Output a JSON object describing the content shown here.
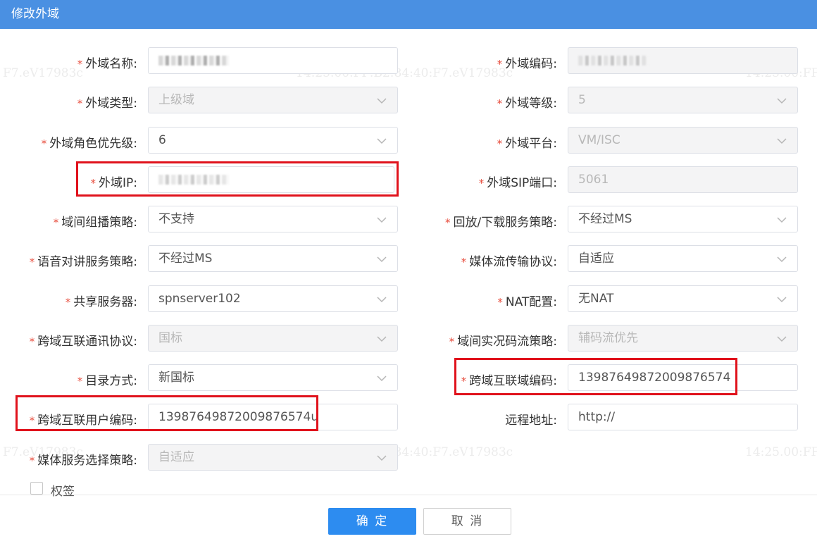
{
  "dialog": {
    "title": "修改外域"
  },
  "watermark": {
    "a": "F7.eV17983c",
    "b": "14:25.00:FF:B2:84:40:F7.eV17983c",
    "c": "14:25.00:FF:"
  },
  "fields": {
    "name": {
      "label": "外域名称:",
      "value": ""
    },
    "code": {
      "label": "外域编码:",
      "value": ""
    },
    "type": {
      "label": "外域类型:",
      "value": "上级域"
    },
    "level": {
      "label": "外域等级:",
      "value": "5"
    },
    "role": {
      "label": "外域角色优先级:",
      "value": "6"
    },
    "platform": {
      "label": "外域平台:",
      "value": "VM/ISC"
    },
    "ip": {
      "label": "外域IP:",
      "value": ""
    },
    "sip_port": {
      "label": "外域SIP端口:",
      "value": "5061"
    },
    "multicast": {
      "label": "域间组播策略:",
      "value": "不支持"
    },
    "playback": {
      "label": "回放/下载服务策略:",
      "value": "不经过MS"
    },
    "voice": {
      "label": "语音对讲服务策略:",
      "value": "不经过MS"
    },
    "transport": {
      "label": "媒体流传输协议:",
      "value": "自适应"
    },
    "share": {
      "label": "共享服务器:",
      "value": "spnserver102"
    },
    "nat": {
      "label": "NAT配置:",
      "value": "无NAT"
    },
    "protocol": {
      "label": "跨域互联通讯协议:",
      "value": "国标"
    },
    "stream": {
      "label": "域间实况码流策略:",
      "value": "辅码流优先"
    },
    "catalog": {
      "label": "目录方式:",
      "value": "新国标"
    },
    "domain_code": {
      "label": "跨域互联域编码:",
      "value": "13987649872009876574"
    },
    "user_code": {
      "label": "跨域互联用户编码:",
      "value": "13987649872009876574u"
    },
    "remote": {
      "label": "远程地址:",
      "value": "http://"
    },
    "media": {
      "label": "媒体服务选择策略:",
      "value": "自适应"
    }
  },
  "signature": {
    "label": "权签",
    "checked": false
  },
  "buttons": {
    "ok": "确 定",
    "cancel": "取 消"
  },
  "colors": {
    "titlebar": "#4a90e2",
    "primary": "#2d8cf0",
    "required": "#e74c3c",
    "highlight": "#e0121c"
  }
}
